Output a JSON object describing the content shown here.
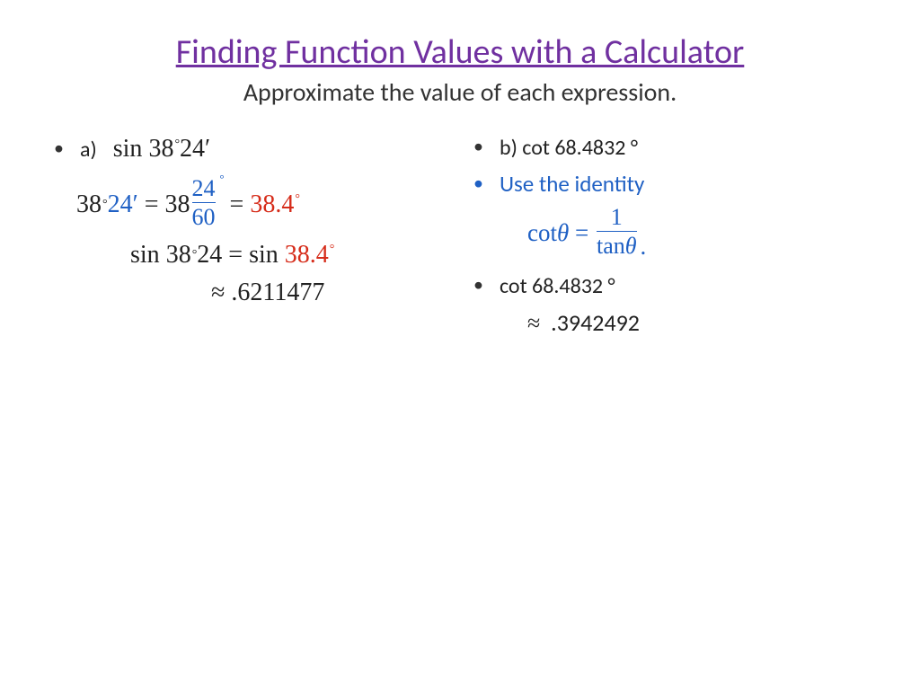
{
  "title": "Finding Function Values with a Calculator",
  "subtitle": "Approximate the value of each expression.",
  "left": {
    "label": "a)",
    "expr_sin": "sin",
    "angle_int": "38",
    "angle_min": "24",
    "conv_eq": "=",
    "conv_38": "38",
    "frac_num": "24",
    "frac_den": "60",
    "conv_result": "38.4",
    "sin_line_prefix": "sin",
    "sin_line_angle1": "38",
    "sin_line_angle2": "24",
    "sin_eq": "=",
    "sin_text": "sin",
    "sin_red": "38.4",
    "approx_sym": "≈",
    "approx_val": ".6211477"
  },
  "right": {
    "label_b": "b) cot 68.4832 °",
    "identity_intro": "Use the identity",
    "cot": "cot",
    "theta": "θ",
    "eq": "=",
    "one": "1",
    "tan": "tan",
    "period": ".",
    "repeat": "cot 68.4832 °",
    "approx_sym": "≈",
    "approx_val": ".3942492"
  }
}
